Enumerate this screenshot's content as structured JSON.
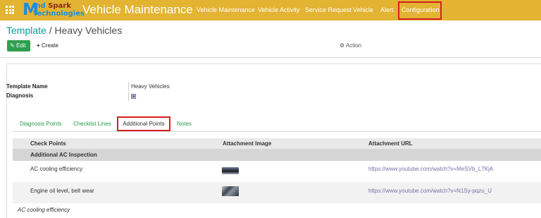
{
  "navbar": {
    "logo": {
      "big_letter": "M",
      "line1_a": "ind",
      "line1_b": "Spark",
      "line2": "Technologies"
    },
    "app_title": "Vehicle Maintenance",
    "menu": [
      "Vehicle Maintenance",
      "Vehicle Activity",
      "Service Request",
      "Vehicle",
      "Alert",
      "Configuration"
    ],
    "colors": {
      "background": "#e3b332",
      "highlight_box": "#d41f1f"
    }
  },
  "breadcrumb": {
    "parent": "Template",
    "separator": "/",
    "current": "Heavy Vehicles"
  },
  "toolbar": {
    "edit_label": "Edit",
    "create_label": "Create",
    "action_label": "Action"
  },
  "form": {
    "template_name_label": "Template Name",
    "template_name_value": "Heavy Vehicles",
    "diagnosis_label": "Diagnosis",
    "diagnosis_checked": true
  },
  "tabs": [
    "Diagnosis Points",
    "Checklist Lines",
    "Additional Points",
    "Notes"
  ],
  "active_tab": "Additional Points",
  "table": {
    "columns": [
      "Check Points",
      "Attachment Image",
      "Attachment URL"
    ],
    "section": "Additional AC Inspection",
    "rows": [
      {
        "check_point": "AC cooling efficiency",
        "image": "car-photo-thumbnail",
        "url": "https://www.youtube.com/watch?v=MeSVb_L7KjA"
      },
      {
        "check_point": "Engine oil level, belt wear",
        "image": "engine-photo-thumbnail",
        "url": "https://www.youtube.com/watch?v=N1Sy-pqzu_U"
      }
    ],
    "note_row": "AC cooling efficiency"
  }
}
